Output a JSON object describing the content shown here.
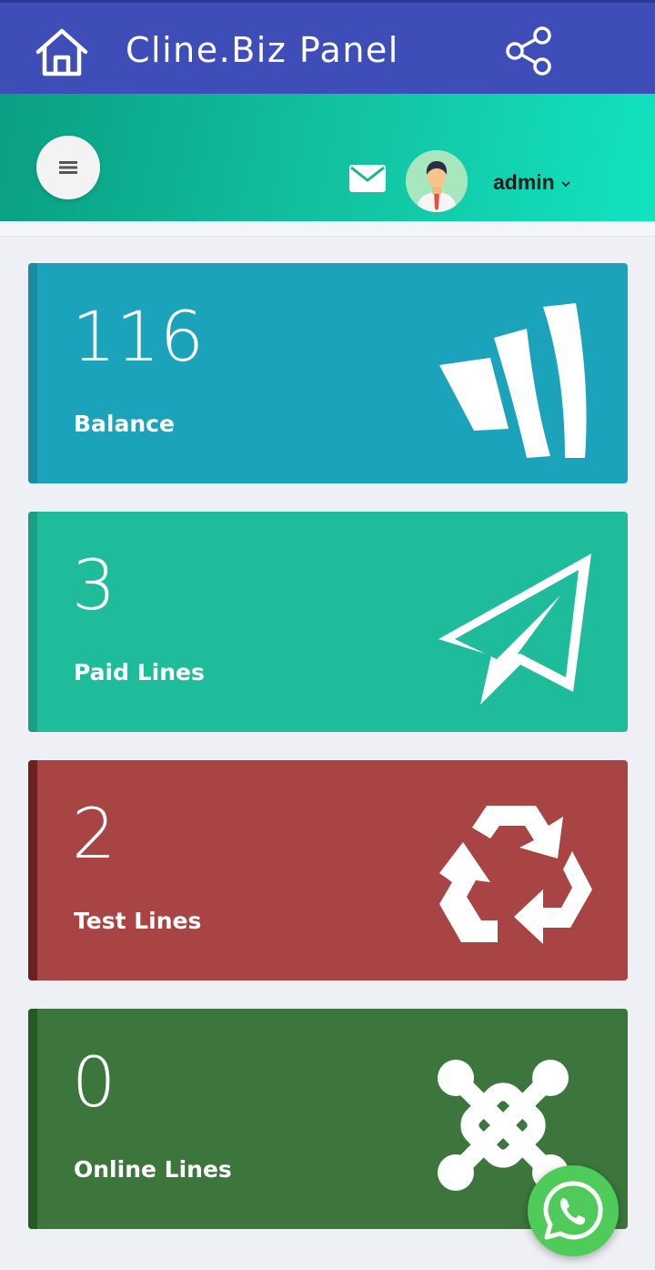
{
  "appbar": {
    "title": "Cline.Biz Panel",
    "home_icon": "home-icon",
    "share_icon": "share-icon"
  },
  "topnav": {
    "menu_icon": "menu-icon",
    "mail_icon": "mail-icon",
    "username": "admin"
  },
  "colors": {
    "appbar": "#3e4db8",
    "balance": "#1ba3bb",
    "paid": "#1fbc9c",
    "test": "#a84443",
    "online": "#3c763d",
    "whatsapp": "#4fcb5a"
  },
  "cards": [
    {
      "value": "116",
      "label": "Balance",
      "icon": "brand-w-icon"
    },
    {
      "value": "3",
      "label": "Paid Lines",
      "icon": "paper-plane-icon"
    },
    {
      "value": "2",
      "label": "Test Lines",
      "icon": "recycle-icon"
    },
    {
      "value": "0",
      "label": "Online Lines",
      "icon": "joomla-icon"
    }
  ],
  "fab": {
    "icon": "whatsapp-icon"
  }
}
